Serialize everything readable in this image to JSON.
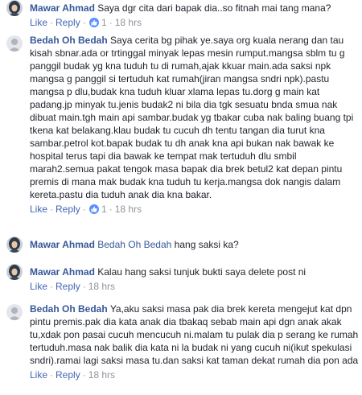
{
  "comments": [
    {
      "author": "Mawar Ahmad",
      "text": "Saya dgr cita dari bapak dia..so fitnah mai tang mana?",
      "like_label": "Like",
      "reply_label": "Reply",
      "like_count": "1",
      "time": "18 hrs"
    },
    {
      "author": "Bedah Oh Bedah",
      "text": "Saya cerita bg pihak ye.saya org kuala nerang dan tau kisah sbnar.ada or trtinggal minyak lepas mesin rumput.mangsa sblm tu g panggil budak yg kna tuduh tu di rumah,ajak kkuar main.ada saksi npk mangsa g panggil si tertuduh kat rumah(jiran mangsa sndri npk).pastu mangsa p dlu,budak kna tuduh kluar xlama lepas tu.dorg g main kat padang.jp minyak tu.jenis budak2 ni bila dia tgk sesuatu bnda smua nak dibuat main.tgh main api sambar.budak yg tbakar cuba nak baling buang tpi tkena kat belakang.klau budak tu cucuh dh tentu tangan dia turut kna sambar.petrol kot.bapak budak tu dh anak kna api bukan nak bawak ke hospital terus tapi dia bawak ke tempat mak tertuduh dlu smbil marah2.semua pakat tengok masa bapak dia brek betul2 kat depan pintu premis di mana mak budak kna tuduh tu kerja.mangsa dok nangis dalam kereta.pastu dia tuduh anak dia kna bakar.",
      "like_label": "Like",
      "reply_label": "Reply",
      "like_count": "1",
      "time": "18 hrs"
    },
    {
      "author": "Mawar Ahmad",
      "mention": "Bedah Oh Bedah",
      "text": "hang saksi ka?"
    },
    {
      "author": "Mawar Ahmad",
      "text": "Kalau hang saksi tunjuk bukti saya delete post ni",
      "like_label": "Like",
      "reply_label": "Reply",
      "time": "18 hrs"
    },
    {
      "author": "Bedah Oh Bedah",
      "text": "Ya,aku saksi masa pak dia brek kereta mengejut kat dpn pintu premis.pak dia kata anak dia tbakaq sebab main api dgn anak akak tu,xdak pon pasai cucuh mencucuh ni.malam tu pulak dia p serang ke rumah tertuduh.masa nak balik dia kata ni la budak ni yang cucuh ni(ikut spekulasi sndri).ramai lagi saksi masa tu.dan saksi kat taman dekat rumah dia pon ada",
      "like_label": "Like",
      "reply_label": "Reply",
      "time": "18 hrs"
    }
  ],
  "colors": {
    "author": "#365899",
    "link": "#4267b2",
    "meta": "#90949c",
    "like_badge": "#5890ff"
  },
  "icons": {
    "avatar_mawar": "hijab-avatar",
    "avatar_bedah": "profile-avatar",
    "like": "thumbs-up-icon"
  }
}
